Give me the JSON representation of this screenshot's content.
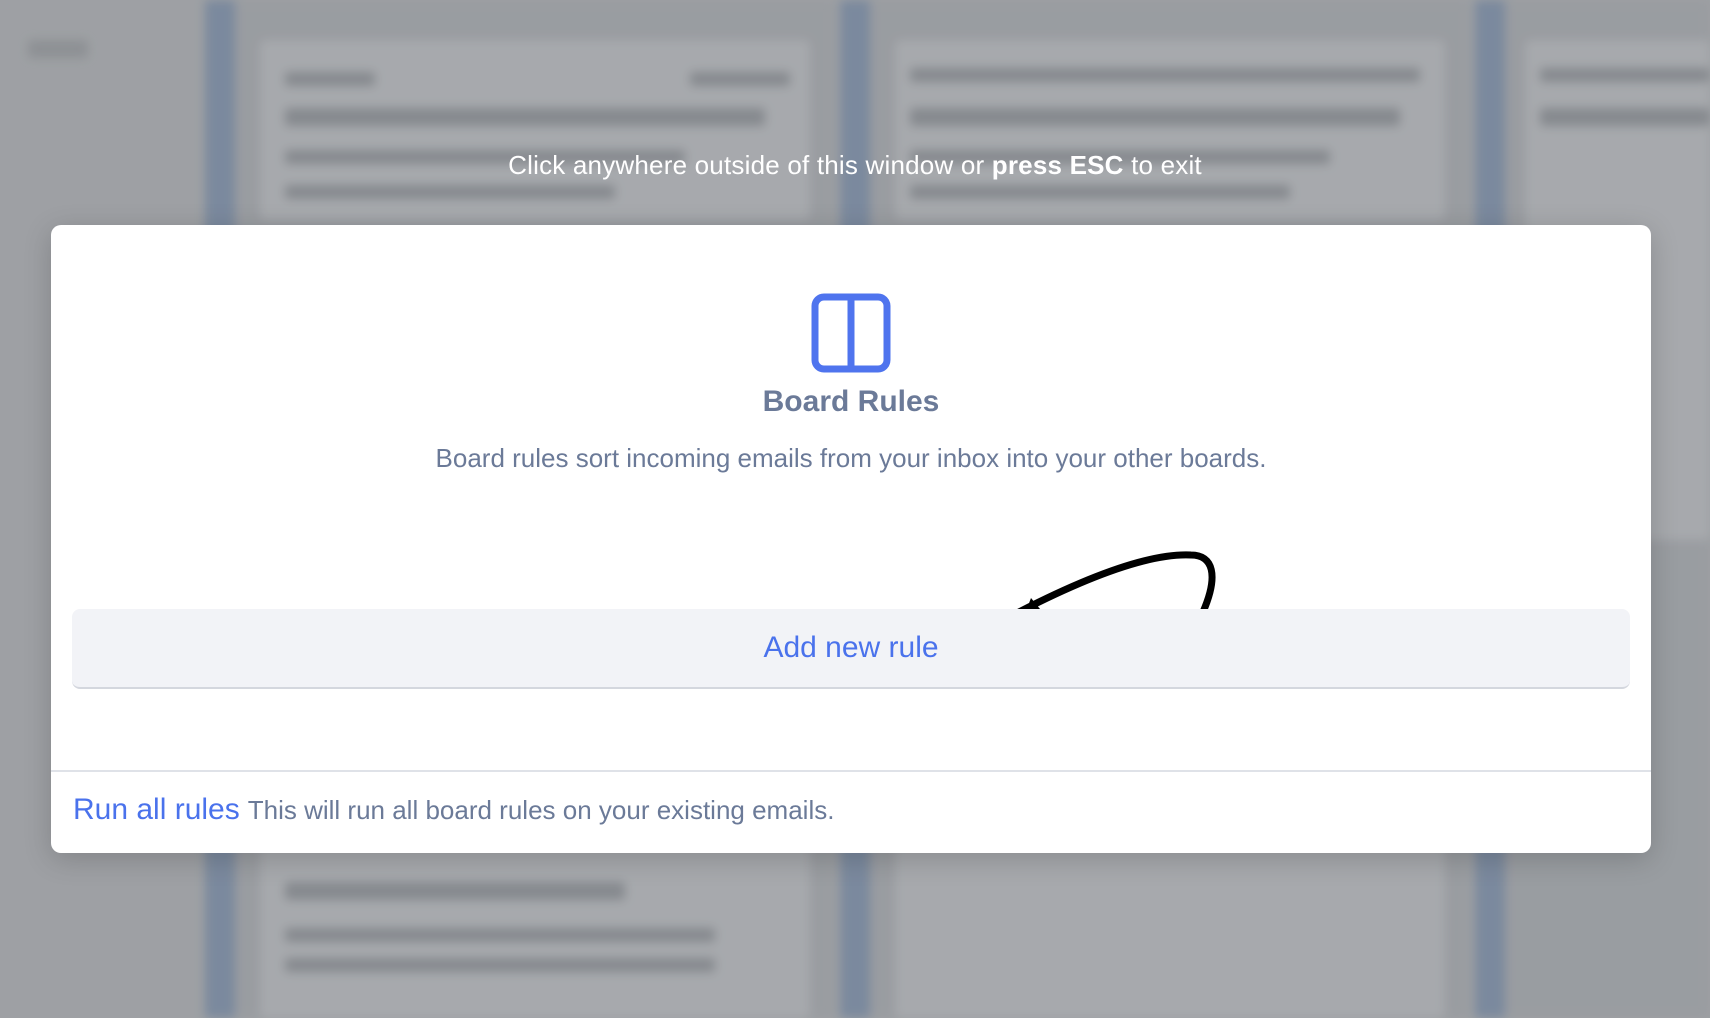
{
  "overlay": {
    "exit_hint_pre": "Click anywhere outside of this window or ",
    "exit_hint_bold": "press ESC",
    "exit_hint_post": " to exit"
  },
  "modal": {
    "icon": "board-columns-icon",
    "title": "Board Rules",
    "description": "Board rules sort incoming emails from your inbox into your other boards.",
    "add_rule_label": "Add new rule",
    "run_all_label": "Run all rules",
    "run_all_description": "This will run all board rules on your existing emails."
  },
  "annotation": {
    "icon": "pointer-arrow"
  },
  "colors": {
    "accent": "#4a72ec",
    "muted_text": "#6b7a98",
    "button_bg": "#f2f3f7",
    "icon_blue": "#4f74ee"
  }
}
